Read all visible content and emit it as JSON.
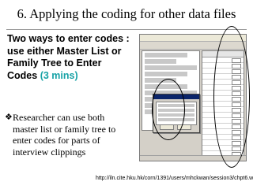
{
  "slide": {
    "title": "6. Applying the coding for other data files",
    "intro": {
      "text": "Two ways to enter codes : use either  Master List or Family Tree to Enter Codes ",
      "duration": "(3 mins)"
    },
    "bullet": {
      "icon": "diamond-bullet-icon",
      "text": "Researcher can use both master list or family tree to enter codes for parts of interview clippings"
    },
    "footer_url": "http://iln.cite.hku.hk/corn/1391/users/mhckwan/session3/chpt6.wmv",
    "accent_color": "#17a2a6"
  }
}
